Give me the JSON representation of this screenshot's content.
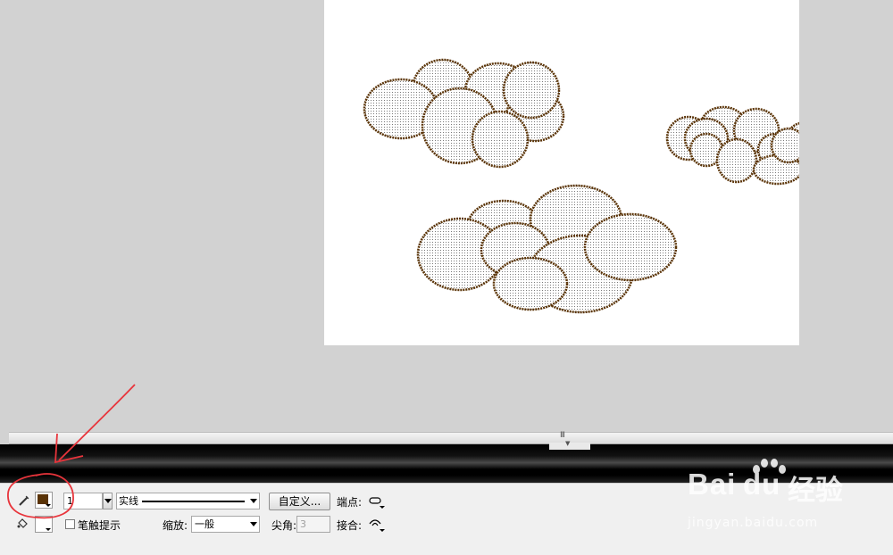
{
  "properties_panel": {
    "stroke_color": "#5a3306",
    "stroke_width_value": "1",
    "stroke_style_value": "实线",
    "custom_button_label": "自定义...",
    "cap_label": "端点:",
    "stroke_hinting_label": "笔触提示",
    "scale_label": "缩放:",
    "scale_value": "一般",
    "miter_label": "尖角:",
    "miter_value": "3",
    "join_label": "接合:"
  },
  "scrollbar": {
    "grip_text": "III"
  },
  "watermark": {
    "brand_latin": "Bai",
    "brand_cn": "经验",
    "url": "jingyan.baidu.com"
  },
  "colors": {
    "cloud_stroke": "#5a3306",
    "annotation": "#e8343b",
    "workspace": "#d2d2d2",
    "stage": "#ffffff"
  }
}
